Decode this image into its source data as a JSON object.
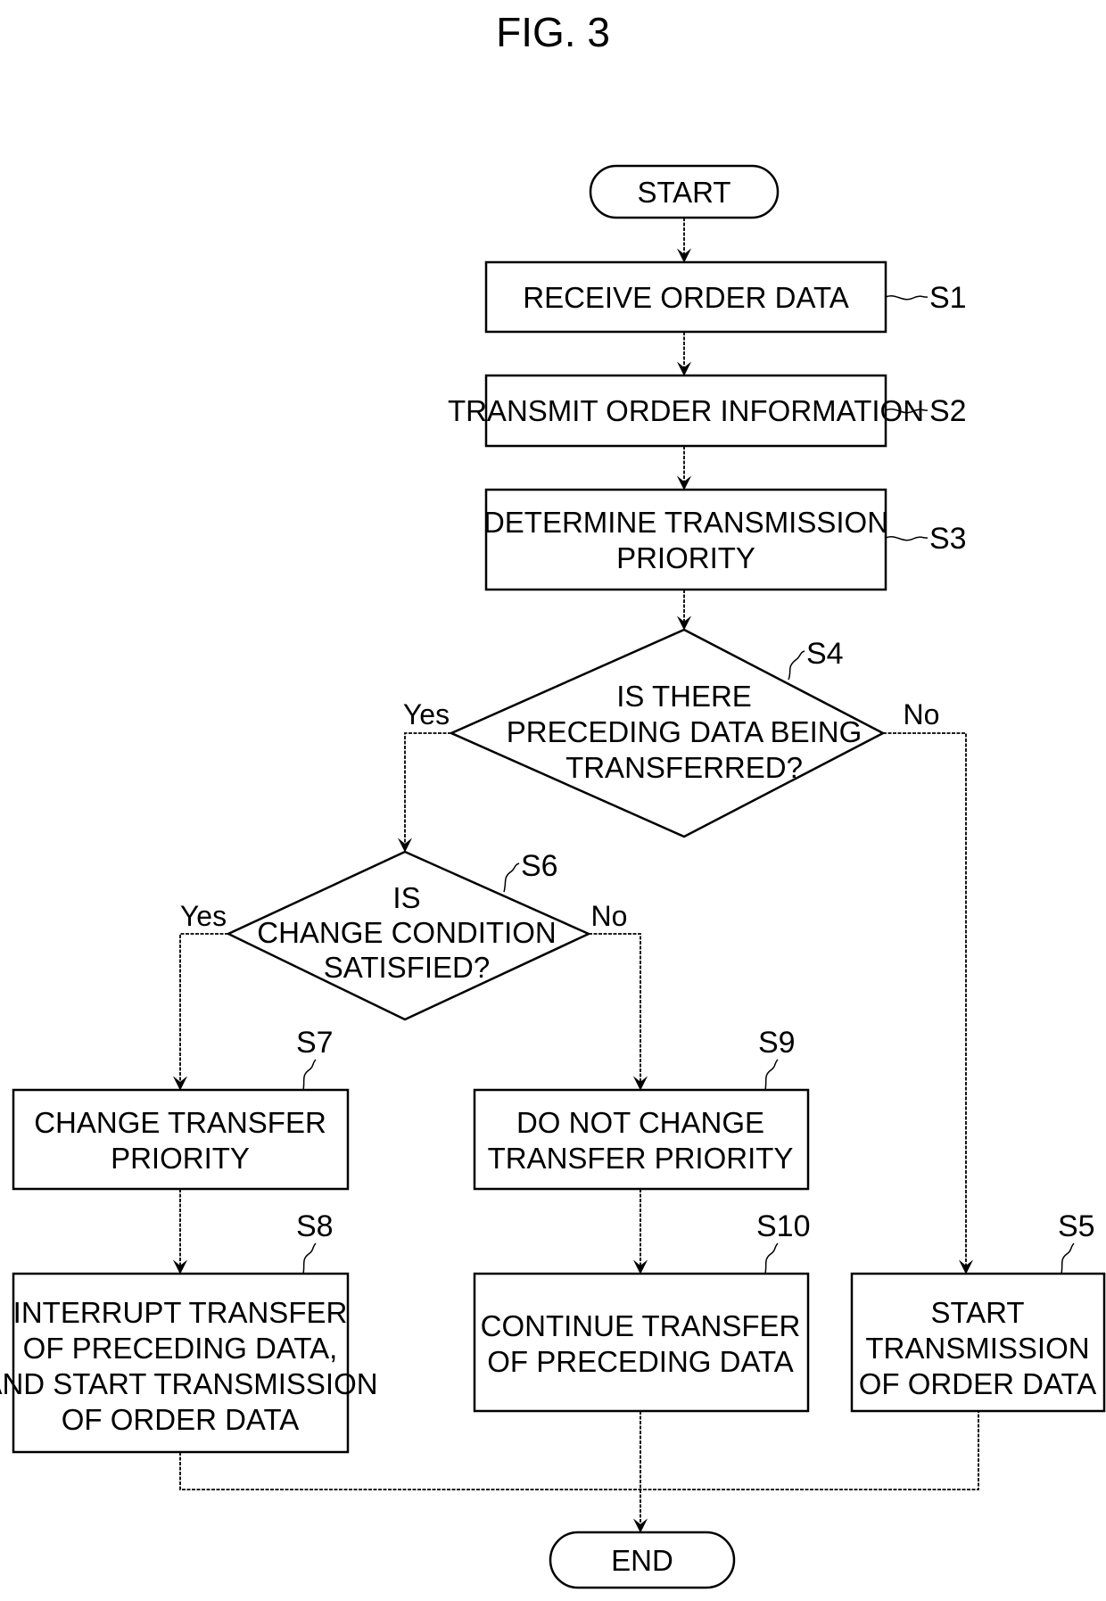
{
  "figure": {
    "title": "FIG. 3"
  },
  "terminals": {
    "start": "START",
    "end": "END"
  },
  "steps": {
    "S1": {
      "label": "S1",
      "lines": [
        "RECEIVE ORDER DATA"
      ]
    },
    "S2": {
      "label": "S2",
      "lines": [
        "TRANSMIT ORDER INFORMATION"
      ]
    },
    "S3": {
      "label": "S3",
      "lines": [
        "DETERMINE TRANSMISSION",
        "PRIORITY"
      ]
    },
    "S4": {
      "label": "S4",
      "lines": [
        "IS THERE",
        "PRECEDING DATA BEING",
        "TRANSFERRED?"
      ],
      "yes": "Yes",
      "no": "No"
    },
    "S5": {
      "label": "S5",
      "lines": [
        "START",
        "TRANSMISSION",
        "OF ORDER DATA"
      ]
    },
    "S6": {
      "label": "S6",
      "lines": [
        "IS",
        "CHANGE CONDITION",
        "SATISFIED?"
      ],
      "yes": "Yes",
      "no": "No"
    },
    "S7": {
      "label": "S7",
      "lines": [
        "CHANGE TRANSFER",
        "PRIORITY"
      ]
    },
    "S8": {
      "label": "S8",
      "lines": [
        "INTERRUPT TRANSFER",
        "OF PRECEDING DATA,",
        "AND START TRANSMISSION",
        "OF ORDER DATA"
      ]
    },
    "S9": {
      "label": "S9",
      "lines": [
        "DO NOT CHANGE",
        "TRANSFER PRIORITY"
      ]
    },
    "S10": {
      "label": "S10",
      "lines": [
        "CONTINUE TRANSFER",
        "OF PRECEDING DATA"
      ]
    }
  }
}
